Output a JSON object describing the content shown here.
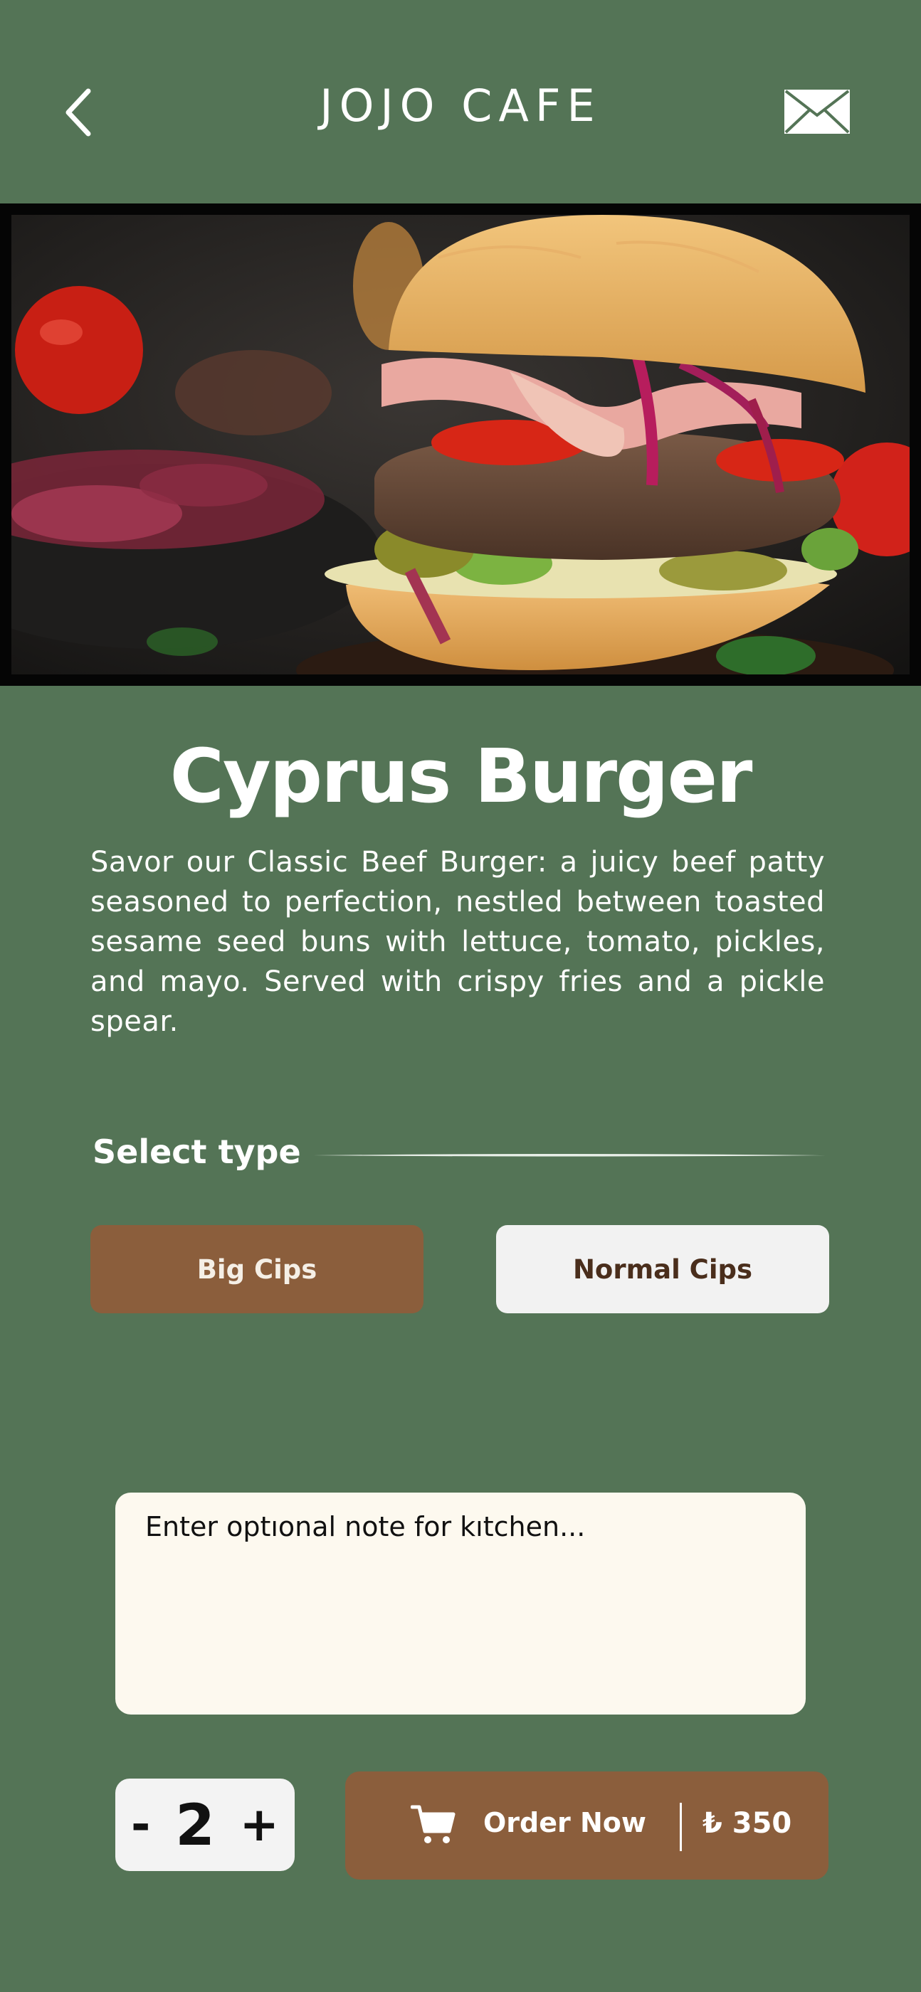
{
  "header": {
    "title": "JOJO CAFE",
    "back_icon": "chevron-left-icon",
    "mail_icon": "envelope-icon"
  },
  "product": {
    "name": "Cyprus Burger",
    "description": "Savor our Classic Beef Burger: a juicy beef patty seasoned to perfection, nestled between toasted sesame seed buns with lettuce, tomato, pickles, and mayo. Served with crispy fries and a pickle spear.",
    "image_subject": "burger-photo"
  },
  "select_type": {
    "label": "Select type",
    "options": [
      "Big Cips",
      "Normal Cips"
    ],
    "selected": "Big Cips"
  },
  "note": {
    "placeholder": "Enter optıonal note for kıtchen...",
    "value": ""
  },
  "quantity": {
    "minus": "-",
    "value": "2",
    "plus": "+"
  },
  "order": {
    "label": "Order Now",
    "price": "₺ 350",
    "icon": "cart-icon"
  },
  "colors": {
    "background": "#547456",
    "accent_brown": "#8b5e3c",
    "light_button": "#f2f2f2",
    "note_bg": "#fdf9ef"
  }
}
